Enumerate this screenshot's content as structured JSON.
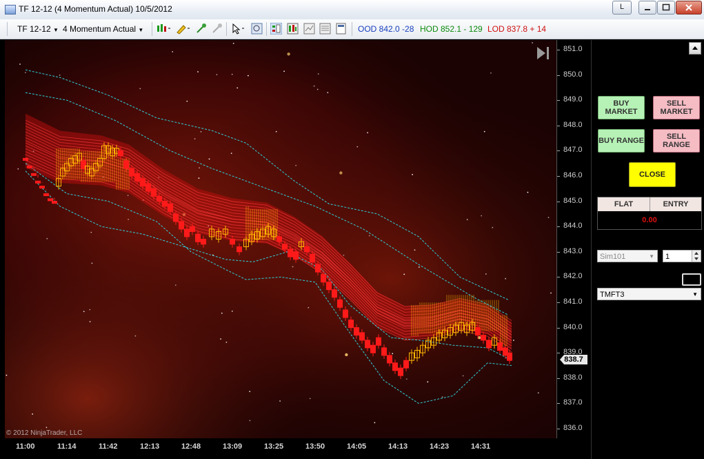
{
  "window": {
    "title": "TF 12-12 (4 Momentum Actual)  10/5/2012",
    "badge": "L"
  },
  "toolbar": {
    "instrument": "TF 12-12",
    "period": "4 Momentum Actual",
    "ood": "OOD  842.0  -28",
    "hod": "HOD  852.1 - 129",
    "lod": "LOD  837.8 + 14"
  },
  "chart": {
    "copyright": "© 2012 NinjaTrader, LLC",
    "current_price": "838.7",
    "y_labels": [
      "851.0",
      "850.0",
      "849.0",
      "848.0",
      "847.0",
      "846.0",
      "845.0",
      "844.0",
      "843.0",
      "842.0",
      "841.0",
      "840.0",
      "839.0",
      "838.0",
      "837.0",
      "836.0"
    ],
    "x_labels": [
      "11:00",
      "11:14",
      "11:42",
      "12:13",
      "12:48",
      "13:09",
      "13:25",
      "13:50",
      "14:05",
      "14:13",
      "14:23",
      "14:31"
    ],
    "colors": {
      "bear": "#ff1a1a",
      "bull": "#ffb800",
      "band": "#2fd0d8",
      "ribbon": "#ff2a2a"
    }
  },
  "chart_data": {
    "type": "line",
    "ylim": [
      835.8,
      851.2
    ],
    "x": [
      "11:00",
      "11:14",
      "11:42",
      "12:13",
      "12:48",
      "13:09",
      "13:25",
      "13:50",
      "14:05",
      "14:13",
      "14:23",
      "14:31"
    ],
    "last_price": 838.7
  },
  "panel": {
    "buy_market": "BUY MARKET",
    "sell_market": "SELL MARKET",
    "buy_range": "BUY RANGE",
    "sell_range": "SELL RANGE",
    "close": "CLOSE",
    "flat": "FLAT",
    "entry": "ENTRY",
    "pnl": "0.00",
    "account": "Sim101",
    "quantity": "1",
    "strategy": "TMFT3"
  }
}
